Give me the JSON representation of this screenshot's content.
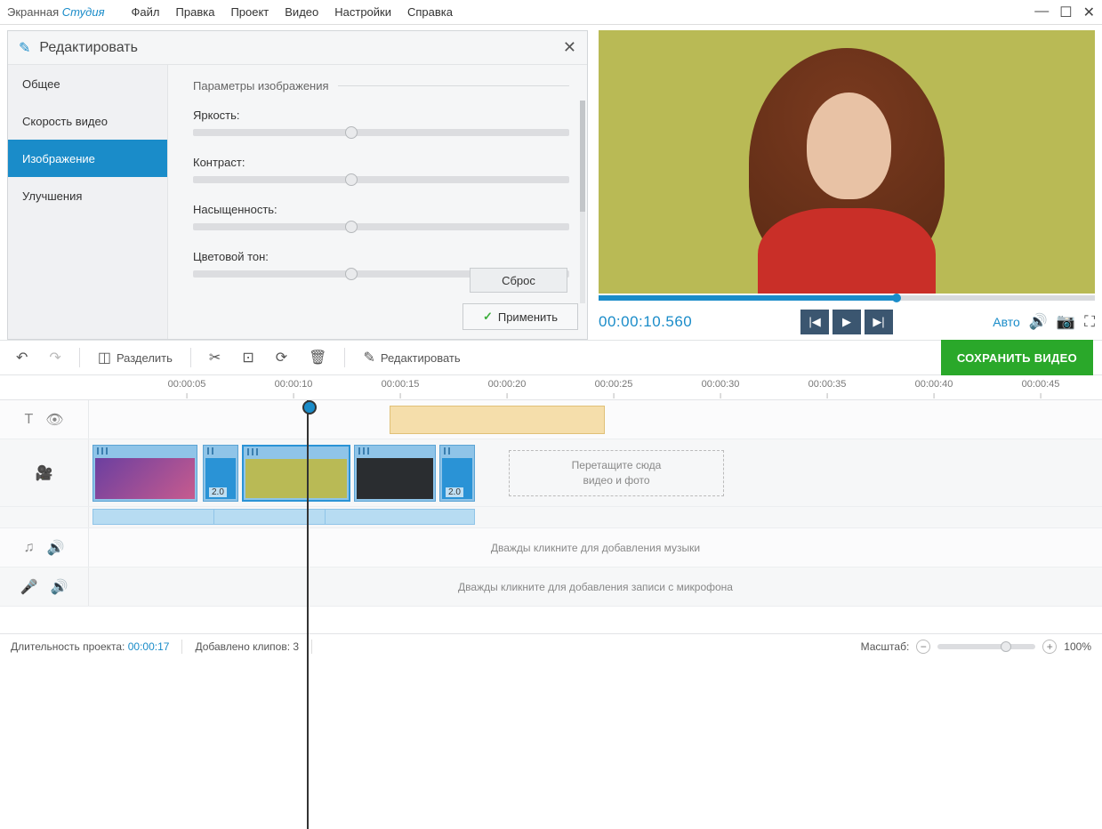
{
  "app": {
    "name1": "Экранная",
    "name2": "Студия"
  },
  "menu": [
    "Файл",
    "Правка",
    "Проект",
    "Видео",
    "Настройки",
    "Справка"
  ],
  "edit": {
    "title": "Редактировать",
    "tabs": [
      "Общее",
      "Скорость видео",
      "Изображение",
      "Улучшения"
    ],
    "active_tab": 2,
    "params_title": "Параметры изображения",
    "sliders": [
      {
        "label": "Яркость:",
        "pos": 42
      },
      {
        "label": "Контраст:",
        "pos": 42
      },
      {
        "label": "Насыщенность:",
        "pos": 42
      },
      {
        "label": "Цветовой тон:",
        "pos": 42
      }
    ],
    "reset": "Сброс",
    "apply": "Применить"
  },
  "preview": {
    "time": "00:00:10.560",
    "progress_pct": 60,
    "auto": "Авто"
  },
  "toolbar": {
    "split": "Разделить",
    "edit": "Редактировать",
    "save": "СОХРАНИТЬ ВИДЕО"
  },
  "ruler": [
    "00:00:05",
    "00:00:10",
    "00:00:15",
    "00:00:20",
    "00:00:25",
    "00:00:30",
    "00:00:35",
    "00:00:40",
    "00:00:45"
  ],
  "clips": {
    "dur_small": "2.0"
  },
  "dropzone": {
    "l1": "Перетащите сюда",
    "l2": "видео и фото"
  },
  "hints": {
    "music": "Дважды кликните для добавления музыки",
    "mic": "Дважды кликните для добавления записи с микрофона"
  },
  "status": {
    "duration_label": "Длительность проекта:",
    "duration": "00:00:17",
    "clips_label": "Добавлено клипов:",
    "clips": "3",
    "zoom_label": "Масштаб:",
    "zoom_pct": "100%"
  }
}
